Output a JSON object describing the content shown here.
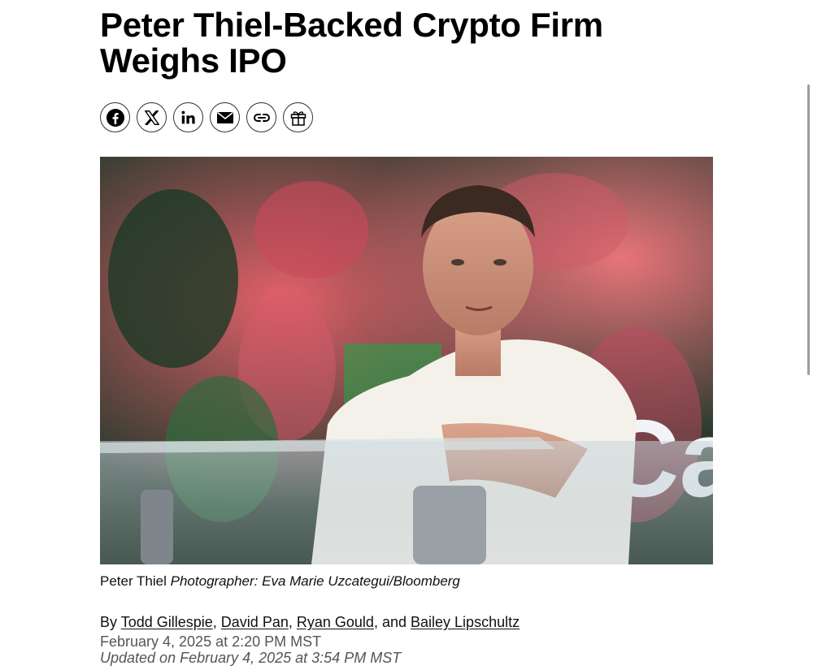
{
  "article": {
    "headline": "Peter Thiel-Backed Crypto Firm Weighs IPO",
    "share": [
      {
        "icon": "facebook-icon",
        "label": "Facebook"
      },
      {
        "icon": "x-icon",
        "label": "X"
      },
      {
        "icon": "linkedin-icon",
        "label": "LinkedIn"
      },
      {
        "icon": "email-icon",
        "label": "Email"
      },
      {
        "icon": "link-icon",
        "label": "Copy link"
      },
      {
        "icon": "gift-icon",
        "label": "Gift"
      }
    ],
    "image": {
      "overlay_text": "Ca"
    },
    "caption": {
      "subject": "Peter Thiel",
      "credit": "Photographer: Eva Marie Uzcategui/Bloomberg"
    },
    "byline": {
      "prefix": "By",
      "authors": [
        "Todd Gillespie",
        "David Pan",
        "Ryan Gould",
        "Bailey Lipschultz"
      ],
      "sep1": ",",
      "sep2": ",",
      "sep3": ", and"
    },
    "published": "February 4, 2025 at 2:20 PM MST",
    "updated": "Updated on February 4, 2025 at 3:54 PM MST"
  },
  "colors": {
    "text": "#000000",
    "muted": "#555555",
    "scrollbar": "#9e9e9e"
  }
}
